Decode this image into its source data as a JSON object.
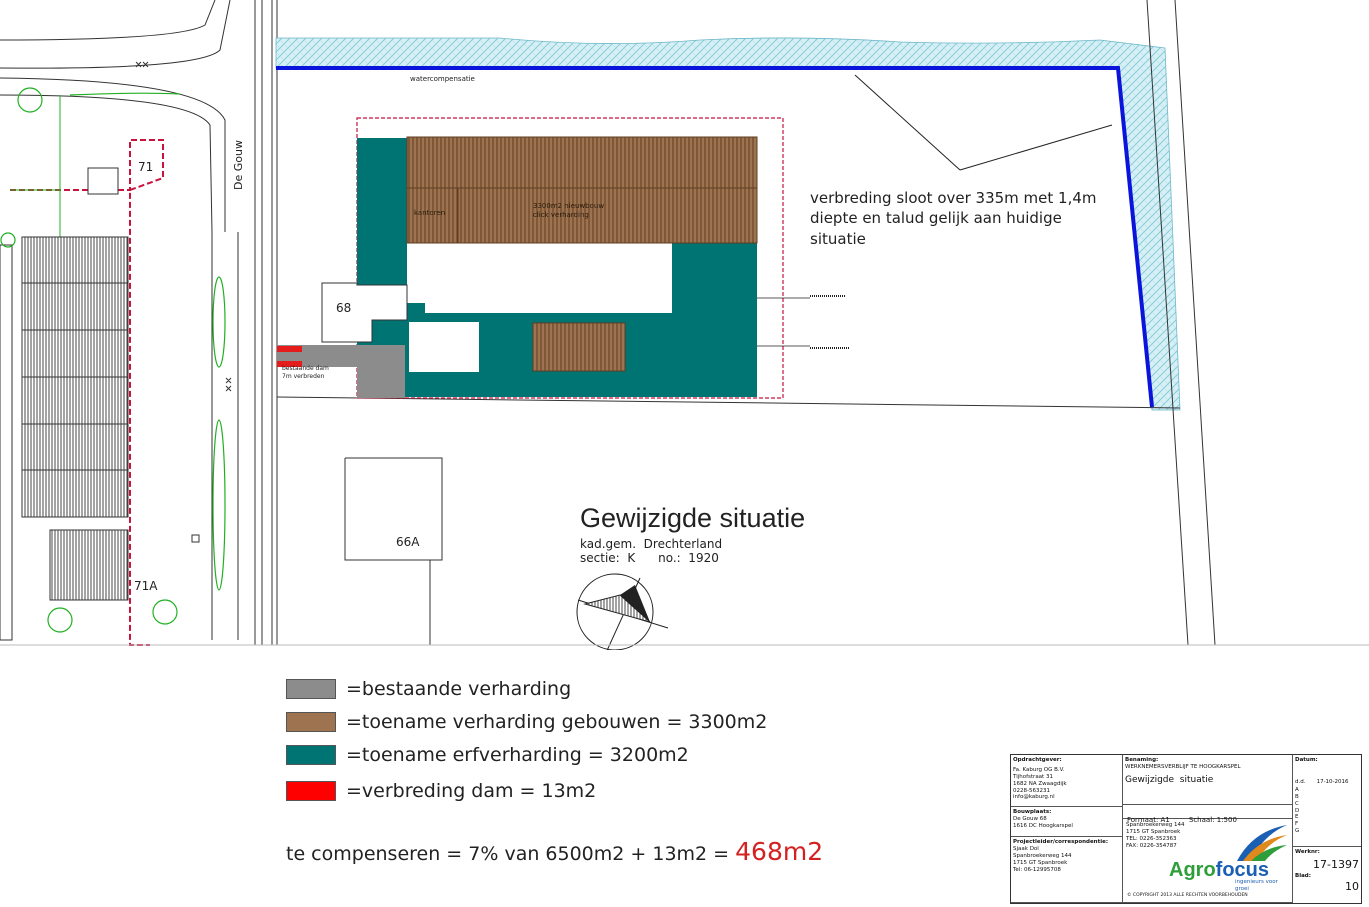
{
  "map": {
    "title": "Gewijzigde situatie",
    "cadastral": {
      "line1": "kad.gem.  Drechterland",
      "line2": "sectie:  K      no.:  1920"
    },
    "street_name": "De Gouw",
    "house_numbers": [
      "71",
      "68",
      "66A",
      "71A"
    ],
    "water_label": "watercompensatie",
    "ditch_note": [
      "verbreding sloot over 335m met 1,4m",
      "diepte en talud gelijk aan huidige",
      "situatie"
    ],
    "dam_note": [
      "bestaande dam",
      "7m verbreden"
    ],
    "building_label_left": "kantoren",
    "building_label_right": [
      "3300m2 nieuwbouw",
      "click verharding"
    ],
    "colors": {
      "existing_paving": "#8c8c8c",
      "new_buildings": "#9e7450",
      "yard_paving": "#007373",
      "dam": "#e41c1c",
      "water_hatch": "#b8e3ec",
      "ditch_line": "#0a14dc",
      "parcel_border": "#c8143c",
      "greenery": "#22b022"
    }
  },
  "legend": {
    "items": [
      {
        "color": "#8c8c8c",
        "label": "=bestaande verharding"
      },
      {
        "color": "#9e7450",
        "label": "=toename verharding gebouwen = 3300m2"
      },
      {
        "color": "#007373",
        "label": "=toename erfverharding  = 3200m2"
      },
      {
        "color": "#ff0000",
        "label": "=verbreding dam   = 13m2"
      }
    ],
    "compensation_text": "te compenseren = 7% van 6500m2 + 13m2 = ",
    "compensation_total": "468m2"
  },
  "title_block": {
    "opdrachtgever_label": "Opdrachtgever:",
    "opdrachtgever_lines": [
      "Fa. Kaburg OG B.V.",
      "Tijhofstraat 31",
      "1682 NA Zwaagdijk",
      "0228-563231",
      "info@kaburg.nl"
    ],
    "bouwplaats_label": "Bouwplaats:",
    "bouwplaats_lines": [
      "De Gouw 68",
      "1616 DC Hoogkarspel"
    ],
    "projectleider_label": "Projectleider/correspondentie:",
    "projectleider_lines": [
      "Sjaak Dol",
      "Spanbroekerweg 144",
      "1715 GT Spanbroek",
      "Tel:     06-12995708"
    ],
    "benaming_label": "Benaming:",
    "benaming_sub": "WERKNEMERSVERBLIJF TE HOOGKARSPEL",
    "benaming_value": "Gewijzigde  situatie",
    "formaat": "Formaat: A1",
    "schaal": "Schaal:  1:500",
    "address_lines": [
      "Spanbroekerweg 144",
      "1715 GT Spanbroek",
      "TEL:    0226-352363",
      "FAX:    0226-354787"
    ],
    "copyright": "© COPYRIGHT 2013 ALLE RECHTEN VOORBEHOUDEN",
    "logo_text_1": "Agro",
    "logo_text_2": "focus",
    "logo_tagline": "ingenieurs voor groei",
    "datum_label": "Datum:",
    "datum_value": "17-10-2016",
    "dd_label": "d.d.",
    "revision_letters": [
      "A",
      "B",
      "C",
      "D",
      "E",
      "F",
      "G"
    ],
    "werknr_label": "Werknr:",
    "werknr_value": "17-1397",
    "blad_label": "Blad:",
    "blad_value": "10"
  }
}
